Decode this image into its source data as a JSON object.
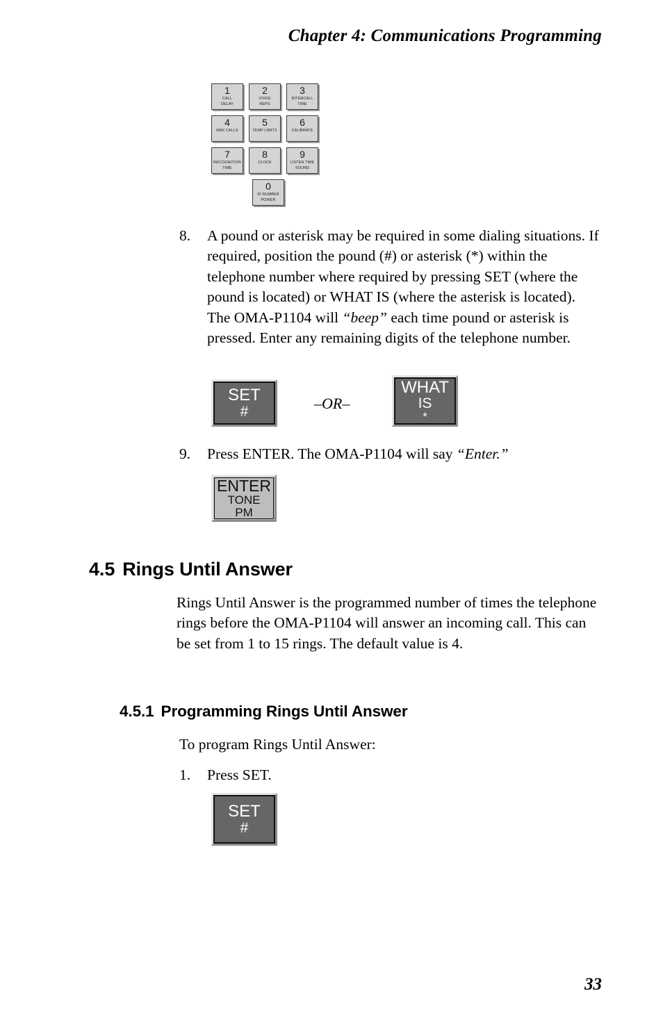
{
  "header": {
    "running_head": "Chapter 4: Communications Programming"
  },
  "keypad": {
    "rows": [
      [
        {
          "digit": "1",
          "sub1": "CALL",
          "sub2": "DELAY"
        },
        {
          "digit": "2",
          "sub1": "VOICE",
          "sub2": "REPS"
        },
        {
          "digit": "3",
          "sub1": "INTERCALL",
          "sub2": "TIME"
        }
      ],
      [
        {
          "digit": "4",
          "sub1": "MAX CALLS",
          "sub2": ""
        },
        {
          "digit": "5",
          "sub1": "TEMP LIMITS",
          "sub2": ""
        },
        {
          "digit": "6",
          "sub1": "CALIBRATE",
          "sub2": ""
        }
      ],
      [
        {
          "digit": "7",
          "sub1": "RECOGNITION",
          "sub2": "TIME"
        },
        {
          "digit": "8",
          "sub1": "CLOCK",
          "sub2": ""
        },
        {
          "digit": "9",
          "sub1": "LISTEN TIME",
          "sub2": "SOUND"
        }
      ],
      [
        {
          "digit": "0",
          "sub1": "ID NUMBER",
          "sub2": "POWER"
        }
      ]
    ]
  },
  "steps": {
    "step8": {
      "number": "8.",
      "text_before_italic": "A pound or asterisk may be required in some dialing situations. If required, position the pound (#) or asterisk (*) within the telephone number where required by pressing SET (where the pound is located) or WHAT IS (where the asterisk is located). The OMA-P1104 will ",
      "italic_word": "“beep”",
      "text_after_italic": " each time pound or asterisk is pressed. Enter any remaining digits of the telephone number."
    },
    "step9": {
      "number": "9.",
      "text_before_italic": "Press ENTER. The OMA-P1104 will say ",
      "italic_word": "“Enter.”",
      "text_after_italic": ""
    },
    "step1": {
      "number": "1.",
      "text": "Press SET."
    }
  },
  "buttons": {
    "set_1": {
      "main": "SET",
      "sub": "#"
    },
    "what_is": {
      "main": "WHAT",
      "sub": "IS",
      "star": "*"
    },
    "enter": {
      "main": "ENTER",
      "sub1": "TONE",
      "sub2": "PM"
    },
    "set_2": {
      "main": "SET",
      "sub": "#"
    },
    "or_label": "–OR–"
  },
  "section_45": {
    "number": "4.5",
    "title": "Rings Until Answer",
    "body": "Rings Until Answer is the programmed number of times the telephone rings before the OMA-P1104 will answer an incoming call. This can be set from 1 to 15 rings. The default value is 4."
  },
  "section_451": {
    "number": "4.5.1",
    "title": "Programming Rings Until Answer",
    "intro": "To program Rings Until Answer:"
  },
  "footer": {
    "page_number": "33"
  },
  "colors": {
    "key_face": "#d4d4d4",
    "dark_button_face": "#666666",
    "light_button_face": "#bdbdbd",
    "text": "#000000"
  }
}
